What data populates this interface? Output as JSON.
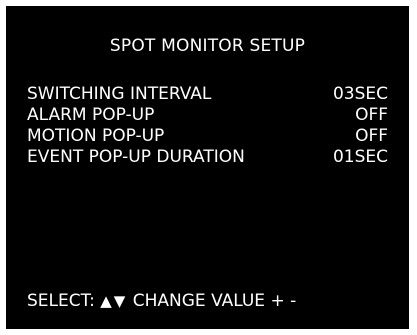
{
  "title": "SPOT MONITOR SETUP",
  "items": [
    {
      "label": "SWITCHING INTERVAL",
      "value": "03SEC"
    },
    {
      "label": "ALARM POP-UP",
      "value": "OFF"
    },
    {
      "label": "MOTION POP-UP",
      "value": "OFF"
    },
    {
      "label": "EVENT POP-UP DURATION",
      "value": "01SEC"
    }
  ],
  "footer": {
    "select_label": "SELECT:",
    "arrows": "▲▼",
    "change_label": "CHANGE VALUE + -"
  },
  "colors": {
    "screen_bg": "#000000",
    "text": "#ffffff",
    "frame": "#ffffff"
  }
}
